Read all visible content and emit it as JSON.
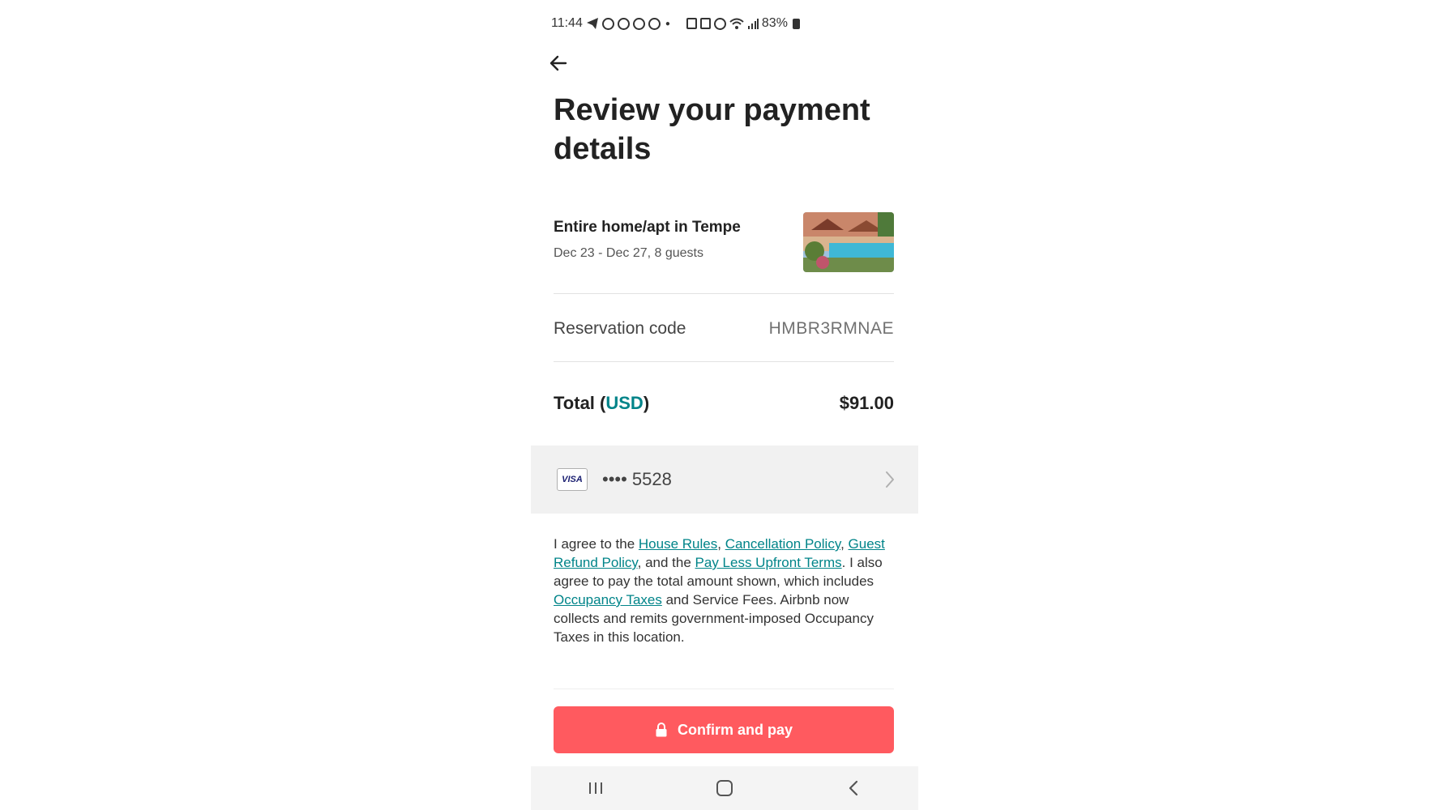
{
  "status_bar": {
    "time": "11:44",
    "battery": "83%"
  },
  "header": {
    "title": "Review your payment details"
  },
  "listing": {
    "title": "Entire home/apt in Tempe",
    "dates_guests": "Dec 23 - Dec 27, 8 guests"
  },
  "reservation": {
    "label": "Reservation code",
    "code": "HMBR3RMNAE"
  },
  "total": {
    "label_prefix": "Total (",
    "currency": "USD",
    "label_suffix": ")",
    "amount": "$91.00"
  },
  "payment": {
    "card_brand": "VISA",
    "card_number": "•••• 5528"
  },
  "agreement": {
    "t1": "I agree to the ",
    "house_rules": "House Rules",
    "t2": ", ",
    "cancellation_policy": "Cancellation Policy",
    "t3": ", ",
    "guest_refund_policy": "Guest Refund Policy",
    "t4": ", and the ",
    "pay_less_upfront_terms": "Pay Less Upfront Terms",
    "t5": ". I also agree to pay the total amount shown, which includes ",
    "occupancy_taxes": "Occupancy Taxes",
    "t6": " and Service Fees. Airbnb now collects and remits government-imposed Occupancy Taxes in this location."
  },
  "confirm_button": {
    "label": "Confirm and pay"
  },
  "colors": {
    "accent_teal": "#008489",
    "confirm_red": "#ff5a5f"
  }
}
